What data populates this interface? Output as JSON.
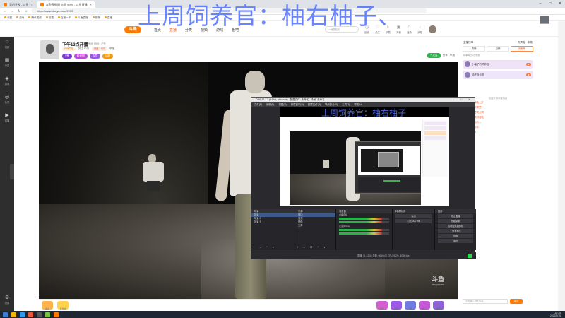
{
  "browser": {
    "tabs": [
      {
        "label": "我的开发 - 斗鱼",
        "active": false
      },
      {
        "label": "斗鱼直播间 房间 9999 - 斗鱼直播",
        "active": true
      }
    ],
    "url": "https://www.douyu.com/9999",
    "bookmarks": [
      "书签",
      "游戏",
      "腾讯视频",
      "设置",
      "百度一下",
      "斗鱼直播",
      "推荐",
      "直播"
    ]
  },
  "overlay_title": "上周饲养官：柚右柚子、",
  "douyu": {
    "logo": "斗鱼",
    "nav": [
      "首页",
      "直播",
      "分类",
      "视频",
      "游戏",
      "鱼吧"
    ],
    "active_nav": "直播",
    "search_placeholder": "一键搜索",
    "header_icons": [
      "历史",
      "关注",
      "下载",
      "开播",
      "登录",
      "消息"
    ],
    "left_sidebar": [
      "推荐",
      "分类",
      "游戏",
      "鱼吧",
      "直播",
      "设置"
    ],
    "room": {
      "title": "下午13点开播",
      "meta": "房间 9999 · 户外",
      "row2": [
        "户外探险",
        "关注 12万",
        "热度 1.8万",
        "举报"
      ],
      "badges": [
        {
          "label": "V榜",
          "color": "#7a3bd1"
        },
        {
          "label": "粉丝团",
          "color": "#c04ad8"
        },
        {
          "label": "会员",
          "color": "#9b59e6"
        },
        {
          "label": "钻粉",
          "color": "#f29a15"
        }
      ],
      "follow_label": "+ 关注",
      "right_items": [
        "分享",
        "举报"
      ]
    },
    "watermark": "斗鱼",
    "watermark_sub": "douyu.com"
  },
  "obs": {
    "title": "OBS 27.1.3 (64-bit, windows) - 配置文件: 未命名 - 场景: 未命名",
    "menu": [
      "文件(F)",
      "编辑(E)",
      "视图(V)",
      "停靠窗口(D)",
      "配置文件(P)",
      "场景集合(S)",
      "工具(T)",
      "帮助(H)"
    ],
    "inner_title": "上周饲养官：柚右柚子",
    "panels": {
      "scenes": {
        "header": "场景",
        "items": [
          "场景",
          "场景 2",
          "场景 3"
        ]
      },
      "sources": {
        "header": "来源",
        "items": [
          "窗口",
          "音频",
          "图像",
          "文本"
        ]
      },
      "mixer": {
        "header": "混音器",
        "items": [
          "桌面音频",
          "麦克风/Aux"
        ],
        "levels": [
          0.62,
          0.48
        ]
      },
      "transitions": {
        "header": "转场特效",
        "items": [
          "淡出",
          "时长 300 ms"
        ]
      },
      "controls": {
        "header": "控件",
        "items": [
          "停止直播",
          "开始录制",
          "启动虚拟摄像机",
          "工作室模式",
          "设置",
          "退出"
        ]
      }
    },
    "status": "直播: 01:12:34    录制: 00:00:00    CPU: 5.2%, 30.00 fps"
  },
  "right_panel": {
    "top_left": "主播榜单",
    "top_right": "贵宾席 · 本场",
    "tabs": [
      "周榜",
      "日榜",
      "贡献榜"
    ],
    "active_tab": "贡献榜",
    "note": "榜单每日0点更新",
    "ranks": [
      {
        "name": "小柚子的饲养官",
        "color": "#f1e3f7"
      },
      {
        "name": "柚子粉丝团",
        "color": "#efe5fb"
      }
    ],
    "chat_sys": "欢迎来到本直播间",
    "chat": [
      "观众A：主播晚上好",
      "观众B：这是哪里？",
      "观众C：注意安全啊",
      "观众D：好黑呀哈哈",
      "观众E：前面有人",
      "观众F：冲冲冲",
      "观众G：666"
    ],
    "input_placeholder": "这里输入聊天内容",
    "send_label": "发送"
  },
  "gifts": [
    {
      "label": "鱼丸",
      "color": "#ffb34d"
    },
    {
      "label": "荧光棒",
      "color": "#ffd24d"
    },
    {
      "label": "办卡",
      "color": "#d25ecf"
    },
    {
      "label": "火箭",
      "color": "#9b59e6"
    },
    {
      "label": "飞机",
      "color": "#6f7be0"
    },
    {
      "label": "超火",
      "color": "#c658d8"
    },
    {
      "label": "魔法",
      "color": "#8c62d6"
    }
  ],
  "taskbar": {
    "time": "18:25",
    "date": "2022/5/15"
  }
}
